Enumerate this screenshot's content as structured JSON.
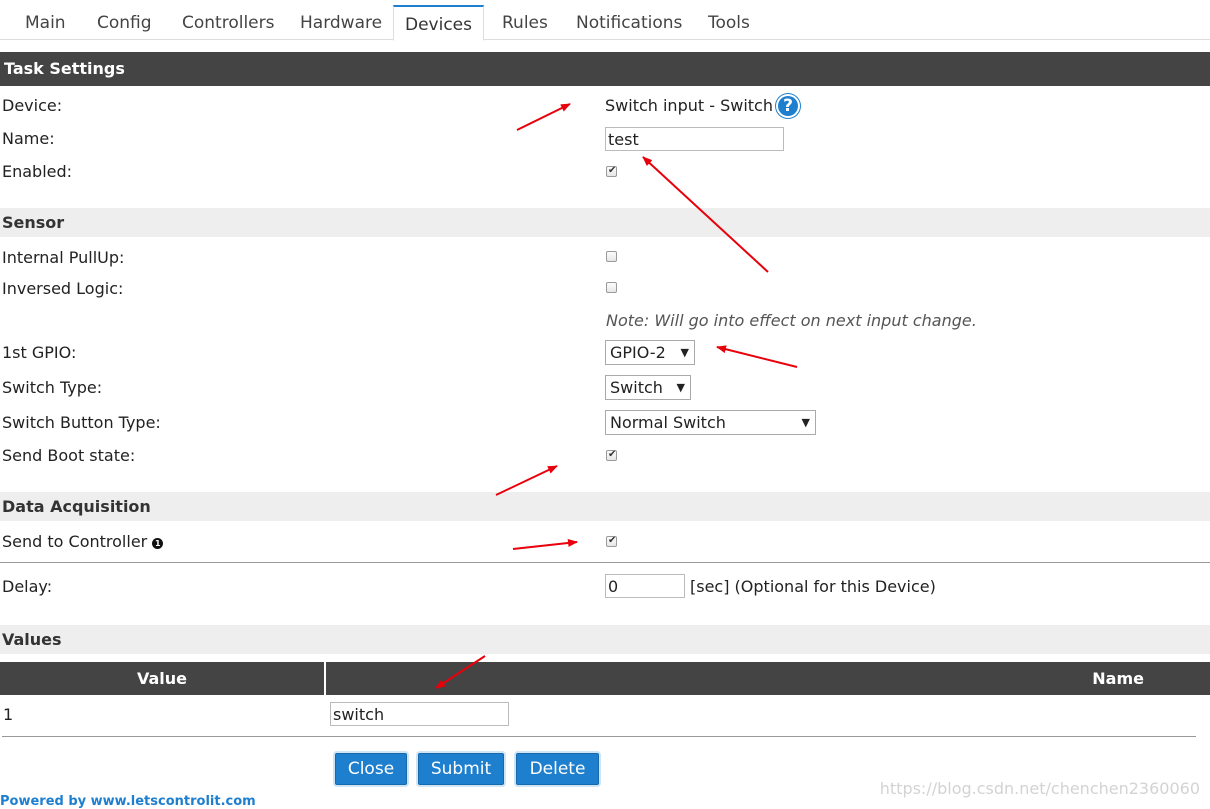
{
  "tabs": [
    "Main",
    "Config",
    "Controllers",
    "Hardware",
    "Devices",
    "Rules",
    "Notifications",
    "Tools"
  ],
  "active_tab": "Devices",
  "task_settings": {
    "title": "Task Settings",
    "device_label": "Device:",
    "device_value": "Switch input - Switch",
    "name_label": "Name:",
    "name_value": "test",
    "enabled_label": "Enabled:",
    "enabled": true
  },
  "sensor": {
    "title": "Sensor",
    "pullup_label": "Internal PullUp:",
    "pullup": false,
    "inversed_label": "Inversed Logic:",
    "inversed": false,
    "note": "Note: Will go into effect on next input change.",
    "gpio_label": "1st GPIO:",
    "gpio_value": "GPIO-2",
    "switch_type_label": "Switch Type:",
    "switch_type_value": "Switch",
    "button_type_label": "Switch Button Type:",
    "button_type_value": "Normal Switch",
    "boot_state_label": "Send Boot state:",
    "boot_state": true
  },
  "data_acquisition": {
    "title": "Data Acquisition",
    "send_label": "Send to Controller",
    "send": true,
    "delay_label": "Delay:",
    "delay_value": "0",
    "delay_suffix": "[sec] (Optional for this Device)"
  },
  "values": {
    "title": "Values",
    "col_value": "Value",
    "col_name": "Name",
    "rows": [
      {
        "value": "1",
        "name": "switch"
      }
    ]
  },
  "buttons": {
    "close": "Close",
    "submit": "Submit",
    "delete": "Delete"
  },
  "footer": "Powered by www.letscontrolit.com",
  "watermark": "https://blog.csdn.net/chenchen2360060",
  "colors": {
    "accent": "#1e7fce",
    "header_bar": "#444444",
    "section_bg": "#eeeeee",
    "annotation_arrow": "#e8000b"
  }
}
